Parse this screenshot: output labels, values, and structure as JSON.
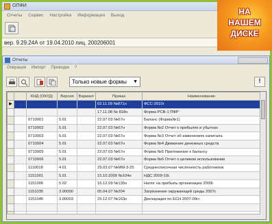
{
  "app": {
    "title": "ОПФИ",
    "menu": [
      "Отчеты",
      "Сервис",
      "Настройка",
      "Информация",
      "Выход"
    ],
    "version_text": "вер. 9.29.24А от 19.04.2010   лиц. 200206001"
  },
  "reports_window": {
    "title": "Отчеты",
    "menu": [
      "Операции",
      "Импорт",
      "Проводки",
      "?"
    ],
    "filter_value": "Только новые формы",
    "help_label": "!"
  },
  "badge": {
    "line1": "НА",
    "line2": "НАШЕМ",
    "line3": "ДИСКЕ"
  },
  "table": {
    "columns": [
      "КНД (ОКУД)",
      "Версия",
      "Вариант",
      "Приказ",
      "Наименование"
    ],
    "rows": [
      {
        "knd": "",
        "ver": "",
        "var": "",
        "order": "02.11.09 №871н",
        "name": "ФСС-2010г",
        "state": "selected"
      },
      {
        "knd": "",
        "ver": "",
        "var": "",
        "order": "17.11.08 № 818н",
        "name": "Форма РСВ-1 ПФР",
        "state": "normal"
      },
      {
        "knd": "0710001",
        "ver": "5.01",
        "var": "",
        "order": "22.07.03 №67н",
        "name": "Баланс (Форма№1)",
        "state": "normal"
      },
      {
        "knd": "0710002",
        "ver": "5.01",
        "var": "",
        "order": "22.07.03 №67н",
        "name": "Форма №2 Отчет о прибылях и убытках",
        "state": "normal"
      },
      {
        "knd": "0710003",
        "ver": "5.01",
        "var": "",
        "order": "22.07.03 №67н",
        "name": "Форма №3 Отчет об изменениях капитала",
        "state": "normal"
      },
      {
        "knd": "0710004",
        "ver": "5.01",
        "var": "",
        "order": "22.07.03 №67н",
        "name": "Форма №4 Движение денежных средств",
        "state": "normal"
      },
      {
        "knd": "0710005",
        "ver": "5.01",
        "var": "",
        "order": "22.07.03 №67н",
        "name": "Форма №5 Приложение к балансу",
        "state": "normal"
      },
      {
        "knd": "0710006",
        "ver": "5.01",
        "var": "",
        "order": "22.07.03 №67н",
        "name": "Форма №6 Отчет о целевом использовании",
        "state": "normal"
      },
      {
        "knd": "1110018",
        "ver": "4.01",
        "var": "",
        "order": "29.03.07 №ММ-3-25",
        "name": "Среднесписочная численность работников",
        "state": "normal"
      },
      {
        "knd": "1151001",
        "ver": "5.01",
        "var": "",
        "order": "15.10.2009 №104н",
        "name": "НДС 2009-10г.",
        "state": "normal"
      },
      {
        "knd": "1151006",
        "ver": "5.02",
        "var": "",
        "order": "16.12.09 №135н",
        "name": "Налог на прибыль организации 2009г.",
        "state": "normal"
      },
      {
        "knd": "1151035",
        "ver": "3.00000",
        "var": "",
        "order": "05.04.07 №204",
        "name": "Загрязнение окружающей среды 2007г.",
        "state": "normal"
      },
      {
        "knd": "1151046",
        "ver": "3.00003",
        "var": "",
        "order": "29.12.07 №163н",
        "name": "Декларация по ЕСН 2007-09гг.",
        "state": "normal"
      },
      {
        "knd": "",
        "ver": "",
        "var": "",
        "order": "",
        "name": "",
        "state": "normal"
      },
      {
        "knd": "",
        "ver": "",
        "var": "",
        "order": "",
        "name": "",
        "state": "normal"
      }
    ]
  }
}
